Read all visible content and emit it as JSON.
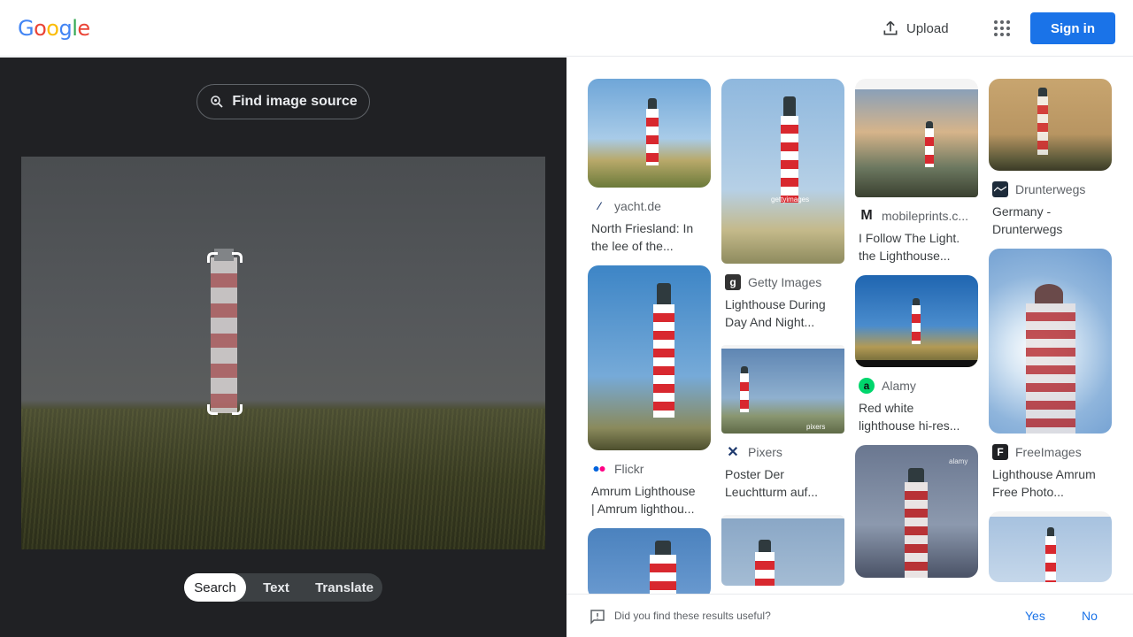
{
  "header": {
    "logo_letters": [
      {
        "char": "G",
        "color": "#4285F4"
      },
      {
        "char": "o",
        "color": "#EA4335"
      },
      {
        "char": "o",
        "color": "#FBBC05"
      },
      {
        "char": "g",
        "color": "#4285F4"
      },
      {
        "char": "l",
        "color": "#34A853"
      },
      {
        "char": "e",
        "color": "#EA4335"
      }
    ],
    "upload_label": "Upload",
    "upload_icon": "upload-icon",
    "apps_icon": "apps-grid-icon",
    "signin_label": "Sign in"
  },
  "lens": {
    "find_source_label": "Find image source",
    "find_source_icon": "lens-search-icon",
    "tabs": [
      "Search",
      "Text",
      "Translate"
    ],
    "active_tab": "Search"
  },
  "results": [
    {
      "source": "yacht.de",
      "title_lines": [
        "North Friesland: In",
        "the lee of the..."
      ],
      "favicon": "yacht-icon"
    },
    {
      "source": "Getty Images",
      "title_lines": [
        "Lighthouse During",
        "Day And Night..."
      ],
      "favicon": "getty-icon"
    },
    {
      "source": "mobileprints.c...",
      "title_lines": [
        "I Follow The Light.",
        "the Lighthouse..."
      ],
      "favicon": "mobileprints-icon"
    },
    {
      "source": "Drunterwegs",
      "title_lines": [
        "Germany -",
        "Drunterwegs"
      ],
      "favicon": "drunterwegs-icon"
    },
    {
      "source": "Flickr",
      "title_lines": [
        "Amrum Lighthouse",
        "| Amrum lighthou..."
      ],
      "favicon": "flickr-icon"
    },
    {
      "source": "Pixers",
      "title_lines": [
        "Poster Der",
        "Leuchtturm auf..."
      ],
      "favicon": "pixers-icon"
    },
    {
      "source": "Alamy",
      "title_lines": [
        "Red white",
        "lighthouse hi-res..."
      ],
      "favicon": "alamy-icon"
    },
    {
      "source": "FreeImages",
      "title_lines": [
        "Lighthouse Amrum",
        "Free Photo..."
      ],
      "favicon": "freeimages-icon"
    }
  ],
  "watermarks": {
    "getty": "gettyimages",
    "pixers": "pixers",
    "alamy": "alamy"
  },
  "feedback": {
    "question": "Did you find these results useful?",
    "yes": "Yes",
    "no": "No",
    "icon": "feedback-icon"
  },
  "colors": {
    "accent": "#1a73e8",
    "dark_panel": "#202124"
  }
}
